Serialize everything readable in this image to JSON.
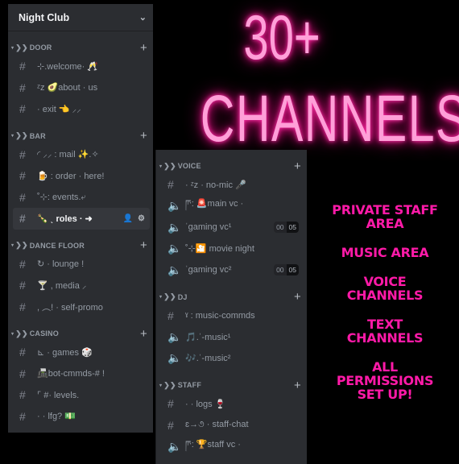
{
  "headline": {
    "line1": "30+",
    "line2": "CHANNELS"
  },
  "features": [
    {
      "line1": "PRIVATE STAFF",
      "line2": "AREA"
    },
    {
      "line1": "MUSIC AREA",
      "line2": ""
    },
    {
      "line1": "VOICE",
      "line2": "CHANNELS"
    },
    {
      "line1": "TEXT",
      "line2": "CHANNELS"
    },
    {
      "line1": "ALL",
      "line2": "PERMISSIONS",
      "line3": "SET UP!"
    }
  ],
  "icons": {
    "text": "#",
    "voice": "🔈",
    "plus": "+",
    "chevron": "⌄",
    "caret": "▾",
    "category": "❯❯"
  },
  "server": {
    "name": "Night Club"
  },
  "left_categories": [
    {
      "name": "DOOR",
      "channels": [
        {
          "type": "text",
          "name": "⊹.welcome· 🥂"
        },
        {
          "type": "text",
          "name": "ᶻz 🥑about · us"
        },
        {
          "type": "text",
          "name": "· exit 👈 ⸝⸝"
        }
      ]
    },
    {
      "name": "BAR",
      "channels": [
        {
          "type": "text",
          "name": "◜ ⸝⸝ : mail ✨.✧"
        },
        {
          "type": "text",
          "name": "🍺 : order · here!"
        },
        {
          "type": "text",
          "name": "˚⊹: events.⤶"
        },
        {
          "type": "text",
          "name": "🍾 ˎ roles · ➜",
          "active": true,
          "extras": [
            "👤",
            "⚙"
          ]
        }
      ]
    },
    {
      "name": "DANCE FLOOR",
      "channels": [
        {
          "type": "text",
          "name": "↻ · lounge !"
        },
        {
          "type": "text",
          "name": "🍸 , media ⸝"
        },
        {
          "type": "text",
          "name": ", ︵! · self-promo"
        }
      ]
    },
    {
      "name": "CASINO",
      "channels": [
        {
          "type": "text",
          "name": "⊾ · games 🎲"
        },
        {
          "type": "text",
          "name": "📠bot-cmmds-# !"
        },
        {
          "type": "text",
          "name": "⌜ #· levels."
        },
        {
          "type": "text",
          "name": "· · lfg? 💵"
        }
      ]
    }
  ],
  "right_categories": [
    {
      "name": "VOICE",
      "channels": [
        {
          "type": "text",
          "name": "· ᶻz · no-mic 🎤"
        },
        {
          "type": "voice",
          "name": "ཫ: 🚨main vc ·"
        },
        {
          "type": "voice",
          "name": "ˈgaming vc¹",
          "count": [
            "00",
            "05"
          ]
        },
        {
          "type": "voice",
          "name": "˚⊹🎦 movie night"
        },
        {
          "type": "voice",
          "name": "ˈgaming vc²",
          "count": [
            "00",
            "05"
          ]
        }
      ]
    },
    {
      "name": "DJ",
      "channels": [
        {
          "type": "text",
          "name": "ˠ : music-commds"
        },
        {
          "type": "voice",
          "name": "🎵.ˈ-music¹"
        },
        {
          "type": "voice",
          "name": "🎶.ˈ-music²"
        }
      ]
    },
    {
      "name": "STAFF",
      "channels": [
        {
          "type": "text",
          "name": "· · logs 🍷"
        },
        {
          "type": "text",
          "name": "ɛ→૭ · staff-chat"
        },
        {
          "type": "voice",
          "name": "ཫ: 🏆staff vc ·"
        }
      ]
    }
  ]
}
